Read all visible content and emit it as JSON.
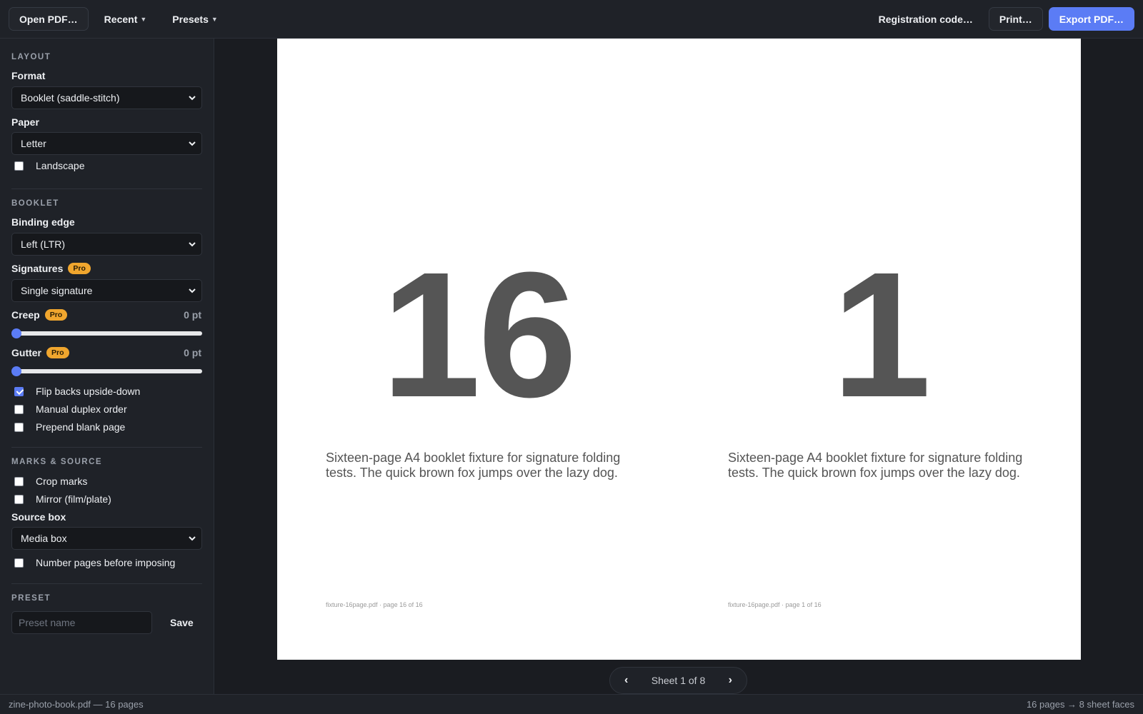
{
  "toolbar": {
    "open_label": "Open PDF…",
    "recent_label": "Recent",
    "presets_label": "Presets",
    "registration_label": "Registration code…",
    "print_label": "Print…",
    "export_label": "Export PDF…"
  },
  "sidebar": {
    "layout": {
      "title": "LAYOUT",
      "format_label": "Format",
      "format_value": "Booklet (saddle-stitch)",
      "paper_label": "Paper",
      "paper_value": "Letter",
      "landscape_label": "Landscape",
      "landscape_checked": false
    },
    "booklet": {
      "title": "BOOKLET",
      "binding_label": "Binding edge",
      "binding_value": "Left (LTR)",
      "signatures_label": "Signatures",
      "signatures_value": "Single signature",
      "pro_badge": "Pro",
      "creep_label": "Creep",
      "creep_value": "0 pt",
      "creep_level": 0,
      "gutter_label": "Gutter",
      "gutter_value": "0 pt",
      "gutter_level": 0,
      "flip_label": "Flip backs upside-down",
      "flip_checked": true,
      "duplex_label": "Manual duplex order",
      "duplex_checked": false,
      "prepend_label": "Prepend blank page",
      "prepend_checked": false
    },
    "marks": {
      "title": "MARKS & SOURCE",
      "crop_label": "Crop marks",
      "crop_checked": false,
      "mirror_label": "Mirror (film/plate)",
      "mirror_checked": false,
      "source_label": "Source box",
      "source_value": "Media box",
      "number_label": "Number pages before imposing",
      "number_checked": false
    },
    "preset": {
      "title": "PRESET",
      "name_placeholder": "Preset name",
      "save_label": "Save"
    }
  },
  "preview": {
    "left_page": {
      "number": "16",
      "blurb": "Sixteen-page A4 booklet fixture for signature folding tests. The quick brown fox jumps over the lazy dog.",
      "footer": "fixture-16page.pdf · page 16 of 16"
    },
    "right_page": {
      "number": "1",
      "blurb": "Sixteen-page A4 booklet fixture for signature folding tests. The quick brown fox jumps over the lazy dog.",
      "footer": "fixture-16page.pdf · page 1 of 16"
    },
    "pager": {
      "prev": "‹",
      "label": "Sheet 1 of 8",
      "next": "›"
    }
  },
  "status": {
    "left": "zine-photo-book.pdf — 16 pages",
    "right": "16 pages → 8 sheet faces"
  },
  "colors": {
    "accent": "#5b7cf5",
    "pro_badge": "#f0a62e"
  }
}
